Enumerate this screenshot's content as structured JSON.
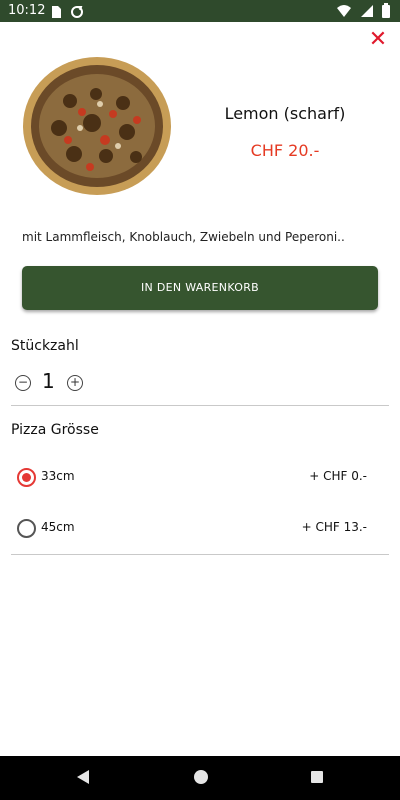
{
  "status_bar": {
    "time": "10:12",
    "left_icons": [
      "sd-card-icon",
      "sync-icon"
    ],
    "right_icons": [
      "wifi-icon",
      "signal-icon",
      "battery-icon"
    ]
  },
  "product": {
    "title": "Lemon (scharf)",
    "price": "CHF 20.-",
    "description": "mit Lammfleisch, Knoblauch, Zwiebeln und Peperoni..",
    "image_icon": "pizza-image"
  },
  "actions": {
    "add_to_cart": "IN DEN WARENKORB",
    "close_icon": "close-icon"
  },
  "quantity": {
    "title": "Stückzahl",
    "value": "1",
    "minus": "−",
    "plus": "+"
  },
  "size": {
    "title": "Pizza Grösse",
    "options": [
      {
        "label": "33cm",
        "price": "+ CHF 0.-",
        "selected": true
      },
      {
        "label": "45cm",
        "price": "+ CHF 13.-",
        "selected": false
      }
    ]
  },
  "colors": {
    "status_bar": "#2f4a2c",
    "button": "#36552f",
    "price": "#e53a23",
    "close": "#e0192c",
    "radio_selected": "#e53935"
  },
  "nav_bar": {
    "icons": [
      "back-icon",
      "home-icon",
      "recent-apps-icon"
    ]
  }
}
